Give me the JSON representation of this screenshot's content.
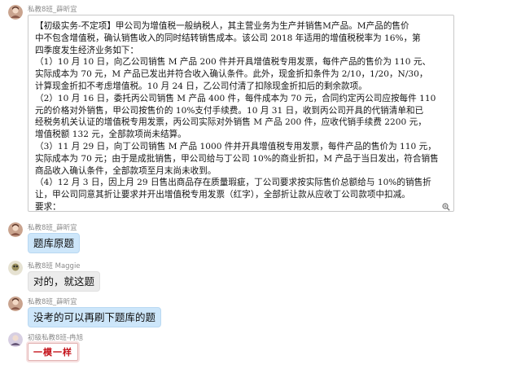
{
  "messages": [
    {
      "sender": "私教8班_薛昕宜",
      "type": "document",
      "lines": [
        "【初级实务-不定项】甲公司为增值税一般纳税人，其主营业务为生产并销售M产品。M产品的售价",
        "中不包含增值税，确认销售收入的同时结转销售成本。该公司 2018 年适用的增值税税率为 16%，第",
        "四季度发生经济业务如下：",
        "（1）10 月 10 日，向乙公司销售 M 产品 200 件并开具增值税专用发票，每件产品的售价为 110 元、",
        "实际成本为 70 元，M 产品已发出并符合收入确认条件。此外，现金折扣条件为 2/10，1/20，N/30，",
        "计算现金折扣不考虑增值税。10 月 24 日，乙公司付清了扣除现金折扣后的剩余款项。",
        "（2）10 月 16 日，委托丙公司销售 M 产品 400 件，每件成本为 70 元，合同约定丙公司应按每件 110",
        "元的价格对外销售，甲公司按售价的 10%支付手续费。10 月 31 日，收到丙公司开具的代销清单和已",
        "经税务机关认证的增值税专用发票，丙公司实际对外销售 M 产品 200 件，应收代销手续费 2200 元，",
        "增值税额 132 元，全部款项尚未结算。",
        "（3）11 月 29 日，向丁公司销售 M 产品 1000 件并开具增值税专用发票，每件产品的售价为 110 元，",
        "实际成本为 70 元；由于是成批销售，甲公司给与丁公司 10%的商业折扣，M 产品于当日发出，符合销售",
        "商品收入确认条件，全部款项至月末尚未收到。",
        "（4）12 月 3 日，因上月 29 日售出商品存在质量瑕疵，丁公司要求按实际售价总额给与 10%的销售折",
        "让，甲公司同意其折让要求并开出增值税专用发票（红字），全部折让款从应收丁公司款项中扣减。",
        "要求："
      ]
    },
    {
      "sender": "私教8班_薛昕宜",
      "type": "text",
      "text": "题库原题"
    },
    {
      "sender": "私教8班 Maggie",
      "type": "text",
      "text": "对的，就这题"
    },
    {
      "sender": "私教8班_薛昕宜",
      "type": "text",
      "text": "没考的可以再刷下题库的题"
    },
    {
      "sender": "初级私教8班-冉旭",
      "type": "sticker",
      "text": "一模一样"
    }
  ],
  "icons": {
    "zoom": "zoom-in-icon",
    "avatar": "avatar"
  },
  "colors": {
    "bubble_blue": "#cde6fa",
    "bubble_gray": "#ececec",
    "sticker_red": "#c4121a"
  }
}
